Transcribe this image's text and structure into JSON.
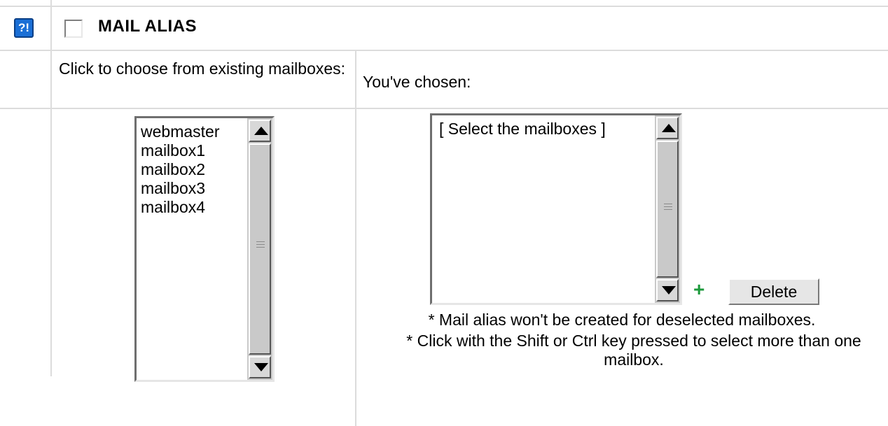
{
  "help_icon": {
    "glyph": "?!",
    "icon": "help-icon"
  },
  "section": {
    "title": "MAIL ALIAS",
    "checked": false
  },
  "labels": {
    "choose": "Click to choose from existing mailboxes:",
    "chosen": "You've chosen:"
  },
  "existing_mailboxes": [
    "webmaster",
    "mailbox1",
    "mailbox2",
    "mailbox3",
    "mailbox4"
  ],
  "chosen_mailboxes": [
    "[ Select the mailboxes ]"
  ],
  "actions": {
    "add_icon": "+",
    "delete_label": "Delete"
  },
  "notes": [
    "* Mail alias won't be created for deselected mailboxes.",
    "* Click with the Shift or Ctrl key pressed to select more than one mailbox."
  ],
  "colors": {
    "help_icon_bg": "#1a6fd6",
    "add_icon": "#1d9a3c",
    "grid": "#dcdcdc"
  }
}
